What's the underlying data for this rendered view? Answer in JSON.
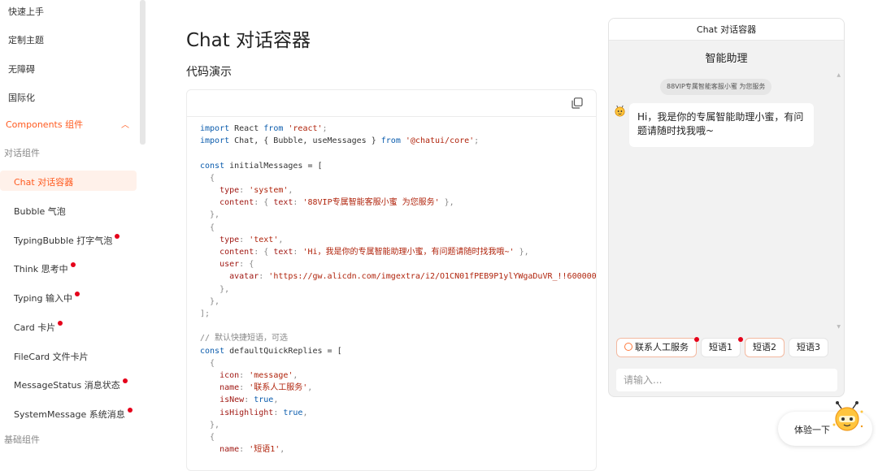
{
  "sidebar": {
    "items": [
      "快速上手",
      "定制主题",
      "无障碍",
      "国际化"
    ],
    "group_label": "Components 组件",
    "category_chat": "对话组件",
    "sub_items": [
      {
        "label": "Chat 对话容器",
        "active": true,
        "dot": false
      },
      {
        "label": "Bubble 气泡",
        "active": false,
        "dot": false
      },
      {
        "label": "TypingBubble 打字气泡",
        "active": false,
        "dot": true
      },
      {
        "label": "Think 思考中",
        "active": false,
        "dot": true
      },
      {
        "label": "Typing 输入中",
        "active": false,
        "dot": true
      },
      {
        "label": "Card 卡片",
        "active": false,
        "dot": true
      },
      {
        "label": "FileCard 文件卡片",
        "active": false,
        "dot": false
      },
      {
        "label": "MessageStatus 消息状态",
        "active": false,
        "dot": true
      },
      {
        "label": "SystemMessage 系统消息",
        "active": false,
        "dot": true
      }
    ],
    "category_basic": "基础组件"
  },
  "main": {
    "title": "Chat 对话容器",
    "subtitle": "代码演示"
  },
  "code": {
    "l1a": "import",
    "l1b": " React ",
    "l1c": "from",
    "l1d": " 'react'",
    "l1e": ";",
    "l2a": "import",
    "l2b": " Chat, { Bubble, useMessages } ",
    "l2c": "from",
    "l2d": " '@chatui/core'",
    "l2e": ";",
    "l4a": "const",
    "l4b": " initialMessages = [",
    "l5": "  {",
    "l6a": "    type",
    "l6b": ": ",
    "l6c": "'system'",
    "l6d": ",",
    "l7a": "    content",
    "l7b": ": { ",
    "l7c": "text",
    "l7d": ": ",
    "l7e": "'88VIP专属智能客服小蜜 为您服务'",
    "l7f": " },",
    "l8": "  },",
    "l9": "  {",
    "l10a": "    type",
    "l10b": ": ",
    "l10c": "'text'",
    "l10d": ",",
    "l11a": "    content",
    "l11b": ": { ",
    "l11c": "text",
    "l11d": ": ",
    "l11e": "'Hi，我是你的专属智能助理小蜜，有问题请随时找我哦~'",
    "l11f": " },",
    "l12a": "    user",
    "l12b": ": {",
    "l13a": "      avatar",
    "l13b": ": ",
    "l13c": "'https://gw.alicdn.com/imgextra/i2/O1CN01fPEB9P1ylYWgaDuVR_!!600000",
    "l14": "    },",
    "l15": "  },",
    "l16": "];",
    "l18": "// 默认快捷短语，可选",
    "l19a": "const",
    "l19b": " defaultQuickReplies = [",
    "l20": "  {",
    "l21a": "    icon",
    "l21b": ": ",
    "l21c": "'message'",
    "l21d": ",",
    "l22a": "    name",
    "l22b": ": ",
    "l22c": "'联系人工服务'",
    "l22d": ",",
    "l23a": "    isNew",
    "l23b": ": ",
    "l23c": "true",
    "l23d": ",",
    "l24a": "    isHighlight",
    "l24b": ": ",
    "l24c": "true",
    "l24d": ",",
    "l25": "  },",
    "l26": "  {",
    "l27a": "    name",
    "l27b": ": ",
    "l27c": "'短语1'",
    "l27d": ","
  },
  "chat": {
    "window_title": "Chat 对话容器",
    "nav_title": "智能助理",
    "system_message": "88VIP专属智能客服小蜜 为您服务",
    "bubble_text": "Hi，我是你的专属智能助理小蜜，有问题请随时找我哦~",
    "quick_replies": [
      {
        "label": "联系人工服务",
        "icon": "message-icon",
        "is_new": true,
        "highlight": true
      },
      {
        "label": "短语1",
        "is_new": true,
        "highlight": false
      },
      {
        "label": "短语2",
        "is_new": false,
        "highlight": true
      },
      {
        "label": "短语3",
        "is_new": false,
        "highlight": false
      }
    ],
    "input_placeholder": "请输入..."
  },
  "try_button": {
    "label": "体验一下"
  },
  "colors": {
    "accent": "#ff5a1f",
    "active_bg": "#fff1ea",
    "new_dot": "#e5001a",
    "keyword": "#0b5cad",
    "string": "#b0240c"
  }
}
